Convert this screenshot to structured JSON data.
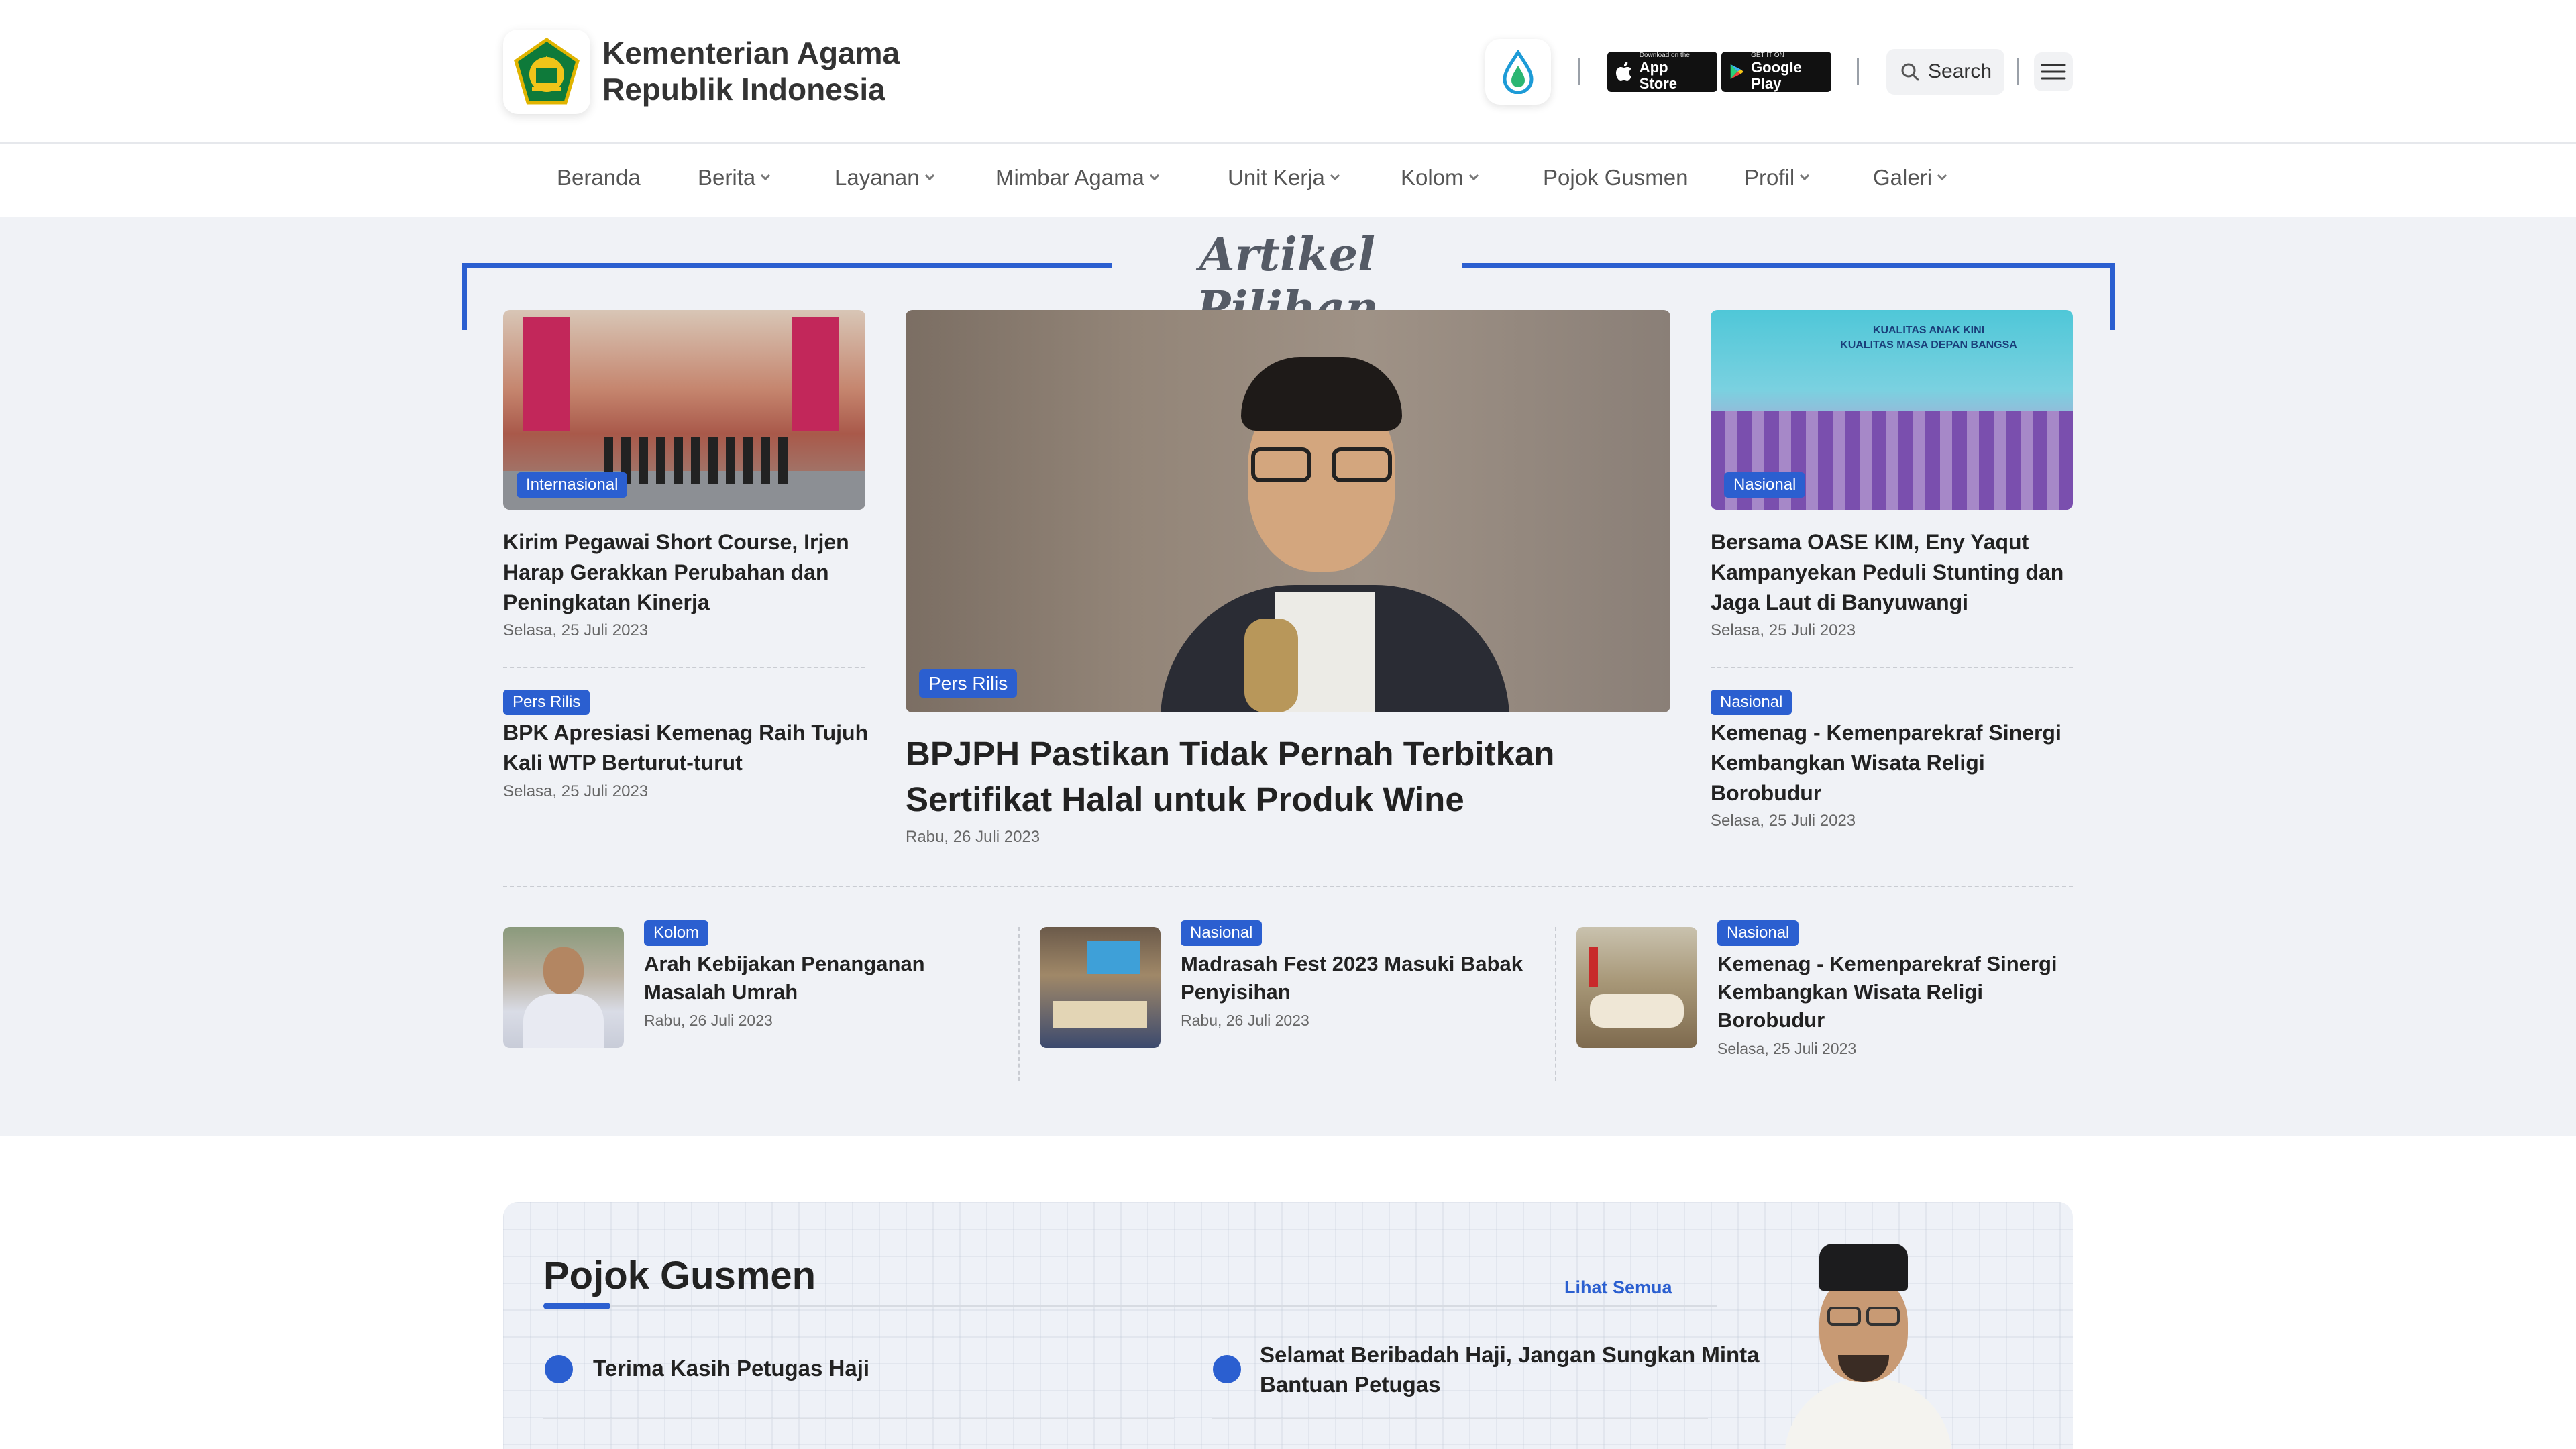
{
  "header": {
    "org_line1": "Kementerian Agama",
    "org_line2": "Republik Indonesia",
    "app_store": {
      "small": "Download on the",
      "big": "App Store"
    },
    "google_play": {
      "small": "GET IT ON",
      "big": "Google Play"
    },
    "search_label": "Search"
  },
  "nav": {
    "items": [
      {
        "label": "Beranda",
        "dropdown": false
      },
      {
        "label": "Berita",
        "dropdown": true
      },
      {
        "label": "Layanan",
        "dropdown": true
      },
      {
        "label": "Mimbar Agama",
        "dropdown": true
      },
      {
        "label": "Unit Kerja",
        "dropdown": true
      },
      {
        "label": "Kolom",
        "dropdown": true
      },
      {
        "label": "Pojok Gusmen",
        "dropdown": false
      },
      {
        "label": "Profil",
        "dropdown": true
      },
      {
        "label": "Galeri",
        "dropdown": true
      }
    ]
  },
  "artikel": {
    "section_title": "Artikel Pilihan",
    "left": [
      {
        "category": "Internasional",
        "title": "Kirim Pegawai Short Course, Irjen Harap Gerakkan Perubahan dan Peningkatan Kinerja",
        "date": "Selasa, 25 Juli 2023"
      },
      {
        "category": "Pers Rilis",
        "title": "BPK Apresiasi Kemenag Raih Tujuh Kali WTP Berturut-turut",
        "date": "Selasa, 25 Juli 2023"
      }
    ],
    "featured": {
      "category": "Pers Rilis",
      "title": "BPJPH Pastikan Tidak Pernah Terbitkan Sertifikat Halal untuk Produk Wine",
      "date": "Rabu, 26 Juli 2023"
    },
    "right": [
      {
        "category": "Nasional",
        "title": "Bersama OASE KIM, Eny Yaqut Kampanyekan Peduli Stunting dan Jaga Laut di Banyuwangi",
        "date": "Selasa, 25 Juli 2023",
        "banner_line1": "KUALITAS ANAK KINI",
        "banner_line2": "KUALITAS MASA DEPAN BANGSA"
      },
      {
        "category": "Nasional",
        "title": "Kemenag - Kemenparekraf Sinergi Kembangkan Wisata Religi Borobudur",
        "date": "Selasa, 25 Juli 2023"
      }
    ],
    "bottom": [
      {
        "category": "Kolom",
        "title": "Arah Kebijakan Penanganan Masalah Umrah",
        "date": "Rabu, 26 Juli 2023"
      },
      {
        "category": "Nasional",
        "title": "Madrasah Fest 2023 Masuki Babak Penyisihan",
        "date": "Rabu, 26 Juli 2023"
      },
      {
        "category": "Nasional",
        "title": "Kemenag - Kemenparekraf Sinergi Kembangkan Wisata Religi Borobudur",
        "date": "Selasa, 25 Juli 2023"
      }
    ]
  },
  "pojok": {
    "title": "Pojok Gusmen",
    "see_all": "Lihat Semua",
    "items": [
      {
        "title": "Terima Kasih Petugas Haji"
      },
      {
        "title": "Selamat Beribadah Haji, Jangan Sungkan Minta Bantuan Petugas"
      }
    ]
  },
  "colors": {
    "accent": "#2b5fd0",
    "section_bg": "#f0f2f6",
    "text": "#222222"
  }
}
